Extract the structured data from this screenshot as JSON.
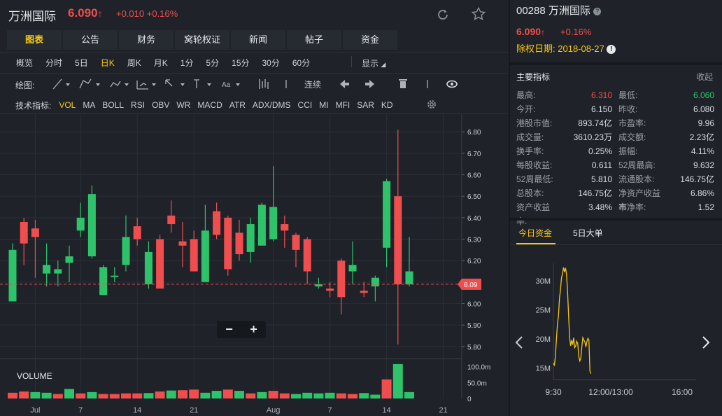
{
  "header": {
    "name": "万洲国际",
    "price": "6.090",
    "up_arrow": "↑",
    "change": "+0.010",
    "change_pct": "+0.16%"
  },
  "tabs": [
    "图表",
    "公告",
    "财务",
    "窝轮权证",
    "新闻",
    "帖子",
    "资金"
  ],
  "active_tab": 0,
  "periods": [
    "概览",
    "分时",
    "5日",
    "日K",
    "周K",
    "月K",
    "1分",
    "5分",
    "15分",
    "30分",
    "60分"
  ],
  "active_period": 3,
  "display_label": "显示",
  "draw_label": "绘图:",
  "draw_tools": [
    "Aa"
  ],
  "continuous_label": "连续",
  "indicator_label": "技术指标:",
  "indicators": [
    "VOL",
    "MA",
    "BOLL",
    "RSI",
    "OBV",
    "WR",
    "MACD",
    "ATR",
    "ADX/DMS",
    "CCI",
    "MI",
    "MFI",
    "SAR",
    "KD"
  ],
  "active_indicator": 0,
  "volume_label": "VOLUME",
  "zoom": {
    "minus": "−",
    "plus": "+"
  },
  "colors": {
    "up": "#f04e4e",
    "down": "#2ec26a",
    "accent": "#f5c518",
    "bg": "#1f2329"
  },
  "chart_data": {
    "type": "candlestick",
    "price_axis_ticks": [
      "6.80",
      "6.70",
      "6.60",
      "6.50",
      "6.40",
      "6.30",
      "6.20",
      "6.10",
      "6.00",
      "5.90",
      "5.80"
    ],
    "ylim": [
      5.77,
      6.83
    ],
    "current_price_label": "6.09",
    "current_price": 6.09,
    "volume_axis_ticks": [
      "100.0m",
      "50.0m",
      "0"
    ],
    "volume_max": 110,
    "x_ticks": [
      {
        "label": "Jul",
        "index": 2
      },
      {
        "label": "7",
        "index": 6
      },
      {
        "label": "14",
        "index": 11
      },
      {
        "label": "21",
        "index": 16
      },
      {
        "label": "Aug",
        "index": 23
      },
      {
        "label": "7",
        "index": 28
      },
      {
        "label": "14",
        "index": 33
      },
      {
        "label": "21",
        "index": 38
      }
    ],
    "candles": [
      {
        "o": 6.01,
        "c": 6.25,
        "h": 6.28,
        "l": 6.03
      },
      {
        "o": 6.38,
        "c": 6.28,
        "h": 6.4,
        "l": 6.18
      },
      {
        "o": 6.35,
        "c": 6.31,
        "h": 6.39,
        "l": 6.12
      },
      {
        "o": 6.14,
        "c": 6.18,
        "h": 6.28,
        "l": 6.08
      },
      {
        "o": 6.14,
        "c": 6.16,
        "h": 6.2,
        "l": 6.08
      },
      {
        "o": 6.19,
        "c": 6.22,
        "h": 6.27,
        "l": 6.1
      },
      {
        "o": 6.34,
        "c": 6.4,
        "h": 6.47,
        "l": 6.31
      },
      {
        "o": 6.22,
        "c": 6.51,
        "h": 6.55,
        "l": 6.21
      },
      {
        "o": 6.04,
        "c": 6.17,
        "h": 6.18,
        "l": 6.04
      },
      {
        "o": 6.13,
        "c": 6.13,
        "h": 6.17,
        "l": 6.1
      },
      {
        "o": 6.18,
        "c": 6.31,
        "h": 6.41,
        "l": 6.15
      },
      {
        "o": 6.36,
        "c": 6.3,
        "h": 6.4,
        "l": 6.27
      },
      {
        "o": 6.09,
        "c": 6.24,
        "h": 6.29,
        "l": 6.07
      },
      {
        "o": 6.3,
        "c": 6.07,
        "h": 6.32,
        "l": 6.07
      },
      {
        "o": 6.41,
        "c": 6.37,
        "h": 6.48,
        "l": 6.33
      },
      {
        "o": 6.29,
        "c": 6.27,
        "h": 6.38,
        "l": 6.17
      },
      {
        "o": 6.3,
        "c": 6.15,
        "h": 6.34,
        "l": 6.15
      },
      {
        "o": 6.1,
        "c": 6.34,
        "h": 6.46,
        "l": 6.1
      },
      {
        "o": 6.43,
        "c": 6.32,
        "h": 6.47,
        "l": 6.3
      },
      {
        "o": 6.4,
        "c": 6.16,
        "h": 6.41,
        "l": 6.13
      },
      {
        "o": 6.33,
        "c": 6.23,
        "h": 6.39,
        "l": 6.2
      },
      {
        "o": 6.24,
        "c": 6.37,
        "h": 6.4,
        "l": 6.19
      },
      {
        "o": 6.27,
        "c": 6.46,
        "h": 6.47,
        "l": 6.27
      },
      {
        "o": 6.3,
        "c": 6.45,
        "h": 6.64,
        "l": 6.29
      },
      {
        "o": 6.37,
        "c": 6.34,
        "h": 6.41,
        "l": 6.26
      },
      {
        "o": 6.32,
        "c": 6.25,
        "h": 6.33,
        "l": 6.17
      },
      {
        "o": 6.3,
        "c": 6.15,
        "h": 6.31,
        "l": 6.09
      },
      {
        "o": 6.08,
        "c": 6.09,
        "h": 6.12,
        "l": 6.07
      },
      {
        "o": 6.07,
        "c": 6.06,
        "h": 6.1,
        "l": 6.03
      },
      {
        "o": 6.2,
        "c": 6.03,
        "h": 6.21,
        "l": 5.95
      },
      {
        "o": 6.15,
        "c": 6.18,
        "h": 6.29,
        "l": 6.09
      },
      {
        "o": 6.06,
        "c": 6.05,
        "h": 6.1,
        "l": 6.03
      },
      {
        "o": 6.08,
        "c": 6.12,
        "h": 6.13,
        "l": 6.01
      },
      {
        "o": 6.26,
        "c": 6.57,
        "h": 6.58,
        "l": 6.17
      },
      {
        "o": 6.5,
        "c": 6.09,
        "h": 6.81,
        "l": 5.81
      },
      {
        "o": 6.09,
        "c": 6.15,
        "h": 6.31,
        "l": 6.08
      }
    ],
    "volumes": [
      {
        "v": 18,
        "up": true
      },
      {
        "v": 22,
        "up": true
      },
      {
        "v": 20,
        "up": false
      },
      {
        "v": 18,
        "up": false
      },
      {
        "v": 14,
        "up": true
      },
      {
        "v": 30,
        "up": false
      },
      {
        "v": 16,
        "up": true
      },
      {
        "v": 20,
        "up": false
      },
      {
        "v": 14,
        "up": true
      },
      {
        "v": 14,
        "up": true
      },
      {
        "v": 16,
        "up": true
      },
      {
        "v": 16,
        "up": true
      },
      {
        "v": 17,
        "up": false
      },
      {
        "v": 22,
        "up": true
      },
      {
        "v": 25,
        "up": false
      },
      {
        "v": 26,
        "up": true
      },
      {
        "v": 28,
        "up": true
      },
      {
        "v": 18,
        "up": false
      },
      {
        "v": 24,
        "up": false
      },
      {
        "v": 28,
        "up": true
      },
      {
        "v": 24,
        "up": false
      },
      {
        "v": 16,
        "up": true
      },
      {
        "v": 20,
        "up": false
      },
      {
        "v": 24,
        "up": true
      },
      {
        "v": 16,
        "up": true
      },
      {
        "v": 14,
        "up": false
      },
      {
        "v": 18,
        "up": false
      },
      {
        "v": 16,
        "up": false
      },
      {
        "v": 18,
        "up": false
      },
      {
        "v": 16,
        "up": true
      },
      {
        "v": 14,
        "up": true
      },
      {
        "v": 17,
        "up": false
      },
      {
        "v": 12,
        "up": false
      },
      {
        "v": 60,
        "up": true
      },
      {
        "v": 108,
        "up": false
      },
      {
        "v": 20,
        "up": false
      }
    ]
  },
  "right": {
    "code": "00288",
    "name": "万洲国际",
    "help_icon": "question-icon",
    "price": "6.090",
    "up_arrow": "↑",
    "change_pct": "+0.16%",
    "ex_date_label": "除权日期:",
    "ex_date": "2018-08-27",
    "warn_icon": "info-icon",
    "indicators_title": "主要指标",
    "collapse_label": "收起",
    "metrics": [
      {
        "k1": "最高:",
        "v1": "6.310",
        "c1": "red",
        "k2": "最低:",
        "v2": "6.060",
        "c2": "green"
      },
      {
        "k1": "今开:",
        "v1": "6.150",
        "c1": "",
        "k2": "昨收:",
        "v2": "6.080",
        "c2": ""
      },
      {
        "k1": "港股市值:",
        "v1": "893.74亿",
        "c1": "",
        "k2": "市盈率:",
        "v2": "9.96",
        "c2": ""
      },
      {
        "k1": "成交量:",
        "v1": "3610.23万",
        "c1": "",
        "k2": "成交额:",
        "v2": "2.23亿",
        "c2": ""
      },
      {
        "k1": "换手率:",
        "v1": "0.25%",
        "c1": "",
        "k2": "振幅:",
        "v2": "4.11%",
        "c2": ""
      },
      {
        "k1": "每股收益:",
        "v1": "0.611",
        "c1": "",
        "k2": "52周最高:",
        "v2": "9.632",
        "c2": ""
      },
      {
        "k1": "52周最低:",
        "v1": "5.810",
        "c1": "",
        "k2": "流通股本:",
        "v2": "146.75亿",
        "c2": ""
      },
      {
        "k1": "总股本:",
        "v1": "146.75亿",
        "c1": "",
        "k2": "净资产收益率:",
        "v2": "6.86%",
        "c2": ""
      },
      {
        "k1": "资产收益率:",
        "v1": "3.48%",
        "c1": "",
        "k2": "市净率:",
        "v2": "1.52",
        "c2": ""
      }
    ],
    "subtabs": [
      "今日资金",
      "5日大单"
    ],
    "active_subtab": 0,
    "mini_chart": {
      "type": "line",
      "y_ticks": [
        "30M",
        "25M",
        "20M",
        "15M"
      ],
      "x_ticks": [
        "9:30",
        "12:00/13:00",
        "16:00"
      ],
      "values": [
        15.8,
        15.5,
        17,
        20,
        22.5,
        24,
        27,
        28.5,
        30.5,
        31.2,
        32.3,
        31.5,
        32.2,
        31,
        28,
        24,
        20.2,
        18.8,
        19.8,
        19,
        20.2,
        18.5,
        18.8,
        19.6,
        19.2,
        17,
        16.2,
        16.6,
        18.6,
        20.2,
        19.8,
        19.5,
        18.6,
        19.5,
        20.1,
        19.8,
        14.5,
        14
      ]
    }
  }
}
